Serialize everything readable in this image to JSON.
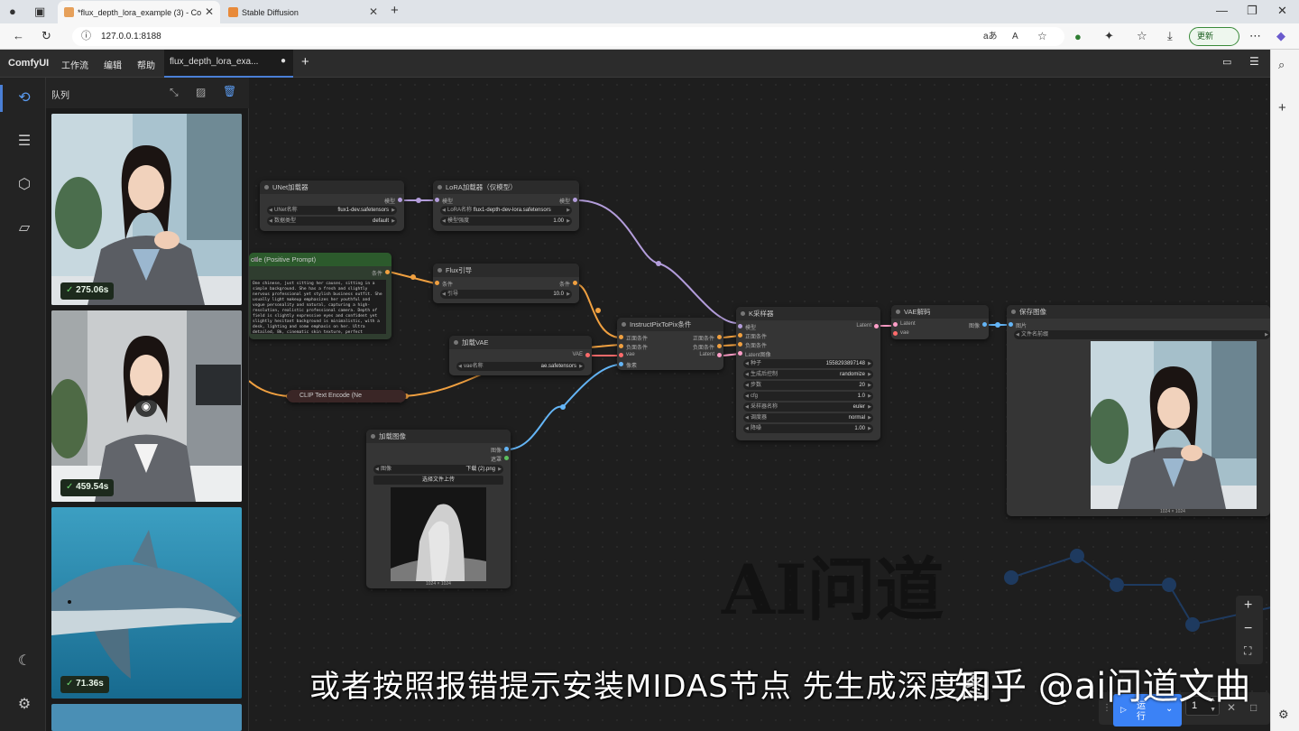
{
  "browser": {
    "tabs": [
      {
        "label": "*flux_depth_lora_example (3) - Co",
        "active": true
      },
      {
        "label": "Stable Diffusion",
        "active": false
      }
    ],
    "url": "127.0.0.1:8188",
    "update_label": "更新"
  },
  "comfy": {
    "logo": "ComfyUI",
    "menus": [
      "工作流",
      "编辑",
      "帮助"
    ],
    "workflow_tab": "flux_depth_lora_exa...",
    "queue_title": "队列",
    "queue_items": [
      {
        "time": "275.06s"
      },
      {
        "time": "459.54s"
      },
      {
        "time": "71.36s"
      }
    ]
  },
  "nodes": {
    "unet": {
      "title": "UNet加载器",
      "out": "模型",
      "w1_label": "UNet名称",
      "w1_val": "flux1-dev.safetensors",
      "w2_label": "数据类型",
      "w2_val": "default"
    },
    "lora": {
      "title": "LoRA加载器（仅模型）",
      "in": "模型",
      "out": "模型",
      "w1_label": "LoRA名称",
      "w1_val": "flux1-depth-dev-lora.safetensors",
      "w2_label": "模型强度",
      "w2_val": "1.00"
    },
    "clip_pos": {
      "title": "ode (Positive Prompt)",
      "out": "条件",
      "text": "One chinese, just sitting her causes, sitting in a simple background. She has a fresh and slightly nervous professional yet stylish business outfit. She usually light makeup emphasizes her youthful and vogue personality and natural, capturing a high-resolution, realistic professional camera. Depth of field is slightly expressive eyes and confident yet slightly hesitant background is minimalistic, with a desk, lighting and some emphasis on her. Ultra detailed, 8k, cinematic skin texture, perfect composition,"
    },
    "flux_guide": {
      "title": "Flux引导",
      "in": "条件",
      "out": "条件",
      "w1_label": "引导",
      "w1_val": "10.0"
    },
    "vae_load": {
      "title": "加载VAE",
      "out": "VAE",
      "w1_label": "vae名称",
      "w1_val": "ae.safetensors"
    },
    "clip_neg": {
      "title": "CLIP Text Encode (Ne"
    },
    "ip2p": {
      "title": "InstructPixToPix条件",
      "in1": "正面条件",
      "in2": "负面条件",
      "in3": "vae",
      "in4": "像素",
      "out1": "正面条件",
      "out2": "负面条件",
      "out3": "Latent"
    },
    "ksampler": {
      "title": "K采样器",
      "in1": "模型",
      "in2": "正面条件",
      "in3": "负面条件",
      "in4": "Latent图像",
      "out": "Latent",
      "widgets": [
        {
          "label": "种子",
          "val": "1558293897148"
        },
        {
          "label": "生成后控制",
          "val": "randomize"
        },
        {
          "label": "步数",
          "val": "20"
        },
        {
          "label": "cfg",
          "val": "1.0"
        },
        {
          "label": "采样器名称",
          "val": "euler"
        },
        {
          "label": "调度器",
          "val": "normal"
        },
        {
          "label": "降噪",
          "val": "1.00"
        }
      ]
    },
    "vae_decode": {
      "title": "VAE解码",
      "in1": "Latent",
      "in2": "vae",
      "out": "图像"
    },
    "save": {
      "title": "保存图像",
      "in": "图片",
      "w1_label": "文件名前缀",
      "size": "1024 × 1024"
    },
    "load_img": {
      "title": "加载图像",
      "out1": "图像",
      "out2": "遮罩",
      "w1_label": "图像",
      "w1_val": "下载 (2).png",
      "upload": "选择文件上传",
      "size": "1024 × 1024"
    }
  },
  "run": {
    "label": "运行",
    "count": "1"
  },
  "overlay": {
    "subtitle": "或者按照报错提示安装MIDAS节点 先生成深度图",
    "zhihu": "知乎 @ai问道文曲",
    "watermark": "AI问道"
  },
  "colors": {
    "accent": "#3b82f6",
    "model_link": "#b39ddb",
    "cond_link": "#f0a040",
    "image_link": "#64b5f6",
    "latent_link": "#ff9ec8",
    "vae_link": "#ff6b6b"
  }
}
